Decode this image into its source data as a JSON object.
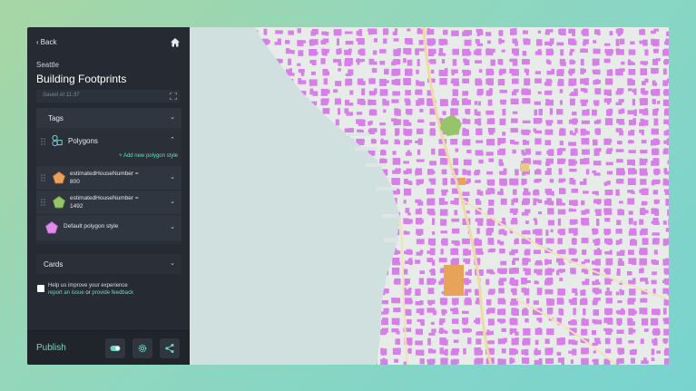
{
  "nav": {
    "back_label": "Back"
  },
  "header": {
    "breadcrumb": "Seattle",
    "title": "Building Footprints",
    "saved_status": "Saved At 11:37"
  },
  "layers": {
    "tags_label": "Tags",
    "polygons_label": "Polygons",
    "add_style_label": "+ Add new polygon style",
    "styles": [
      {
        "text": "estimatedHouseNumber =\n800",
        "color": "#e8a35a"
      },
      {
        "text": "estimatedHouseNumber =\n1492",
        "color": "#97c46a"
      },
      {
        "text": "Default polygon style",
        "color": "#de8bea"
      }
    ]
  },
  "cards_label": "Cards",
  "help": {
    "line1": "Help us improve your experience",
    "report_link": "report an issue",
    "or_text": "or",
    "feedback_link": "provide feedback"
  },
  "footer": {
    "publish_label": "Publish"
  },
  "colors": {
    "accent": "#6fd6c6",
    "sidebar_bg": "#262b33",
    "building_default": "#d77fe8",
    "building_800": "#e8a35a",
    "building_1492": "#97c46a",
    "water": "#cfe0df",
    "land": "#e8ece9"
  },
  "icons": {
    "home": "home-icon",
    "expand": "expand-icon",
    "layers": "layers-icon",
    "toggle": "toggle-icon",
    "settings": "gear-icon",
    "share": "share-icon"
  }
}
